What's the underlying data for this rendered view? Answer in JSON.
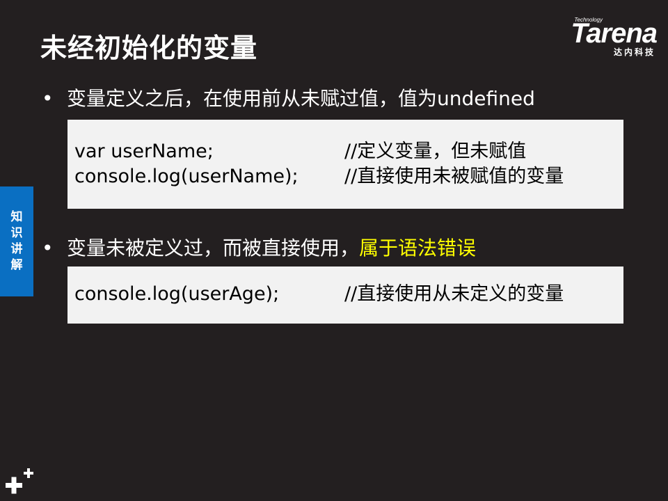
{
  "slide": {
    "title": "未经初始化的变量",
    "logo": {
      "tagline": "Technology",
      "brand": "Tarena",
      "brand_cn": "达内科技"
    },
    "side_tab": {
      "chars": [
        "知",
        "识",
        "讲",
        "解"
      ],
      "color": "#0a6fc2"
    },
    "bullets": [
      {
        "text": "变量定义之后，在使用前从未赋过值，值为undefined",
        "code": [
          {
            "stmt": "var  userName;",
            "comment": "//定义变量，但未赋值"
          },
          {
            "stmt": "console.log(userName);",
            "comment": "//直接使用未被赋值的变量"
          }
        ]
      },
      {
        "text": "变量未被定义过，而被直接使用，",
        "highlight": "属于语法错误",
        "highlight_color": "#ffff00",
        "code": [
          {
            "stmt": "console.log(userAge);",
            "comment": "//直接使用从未定义的变量"
          }
        ]
      }
    ],
    "footer_icon": "plus-plus-icon"
  }
}
